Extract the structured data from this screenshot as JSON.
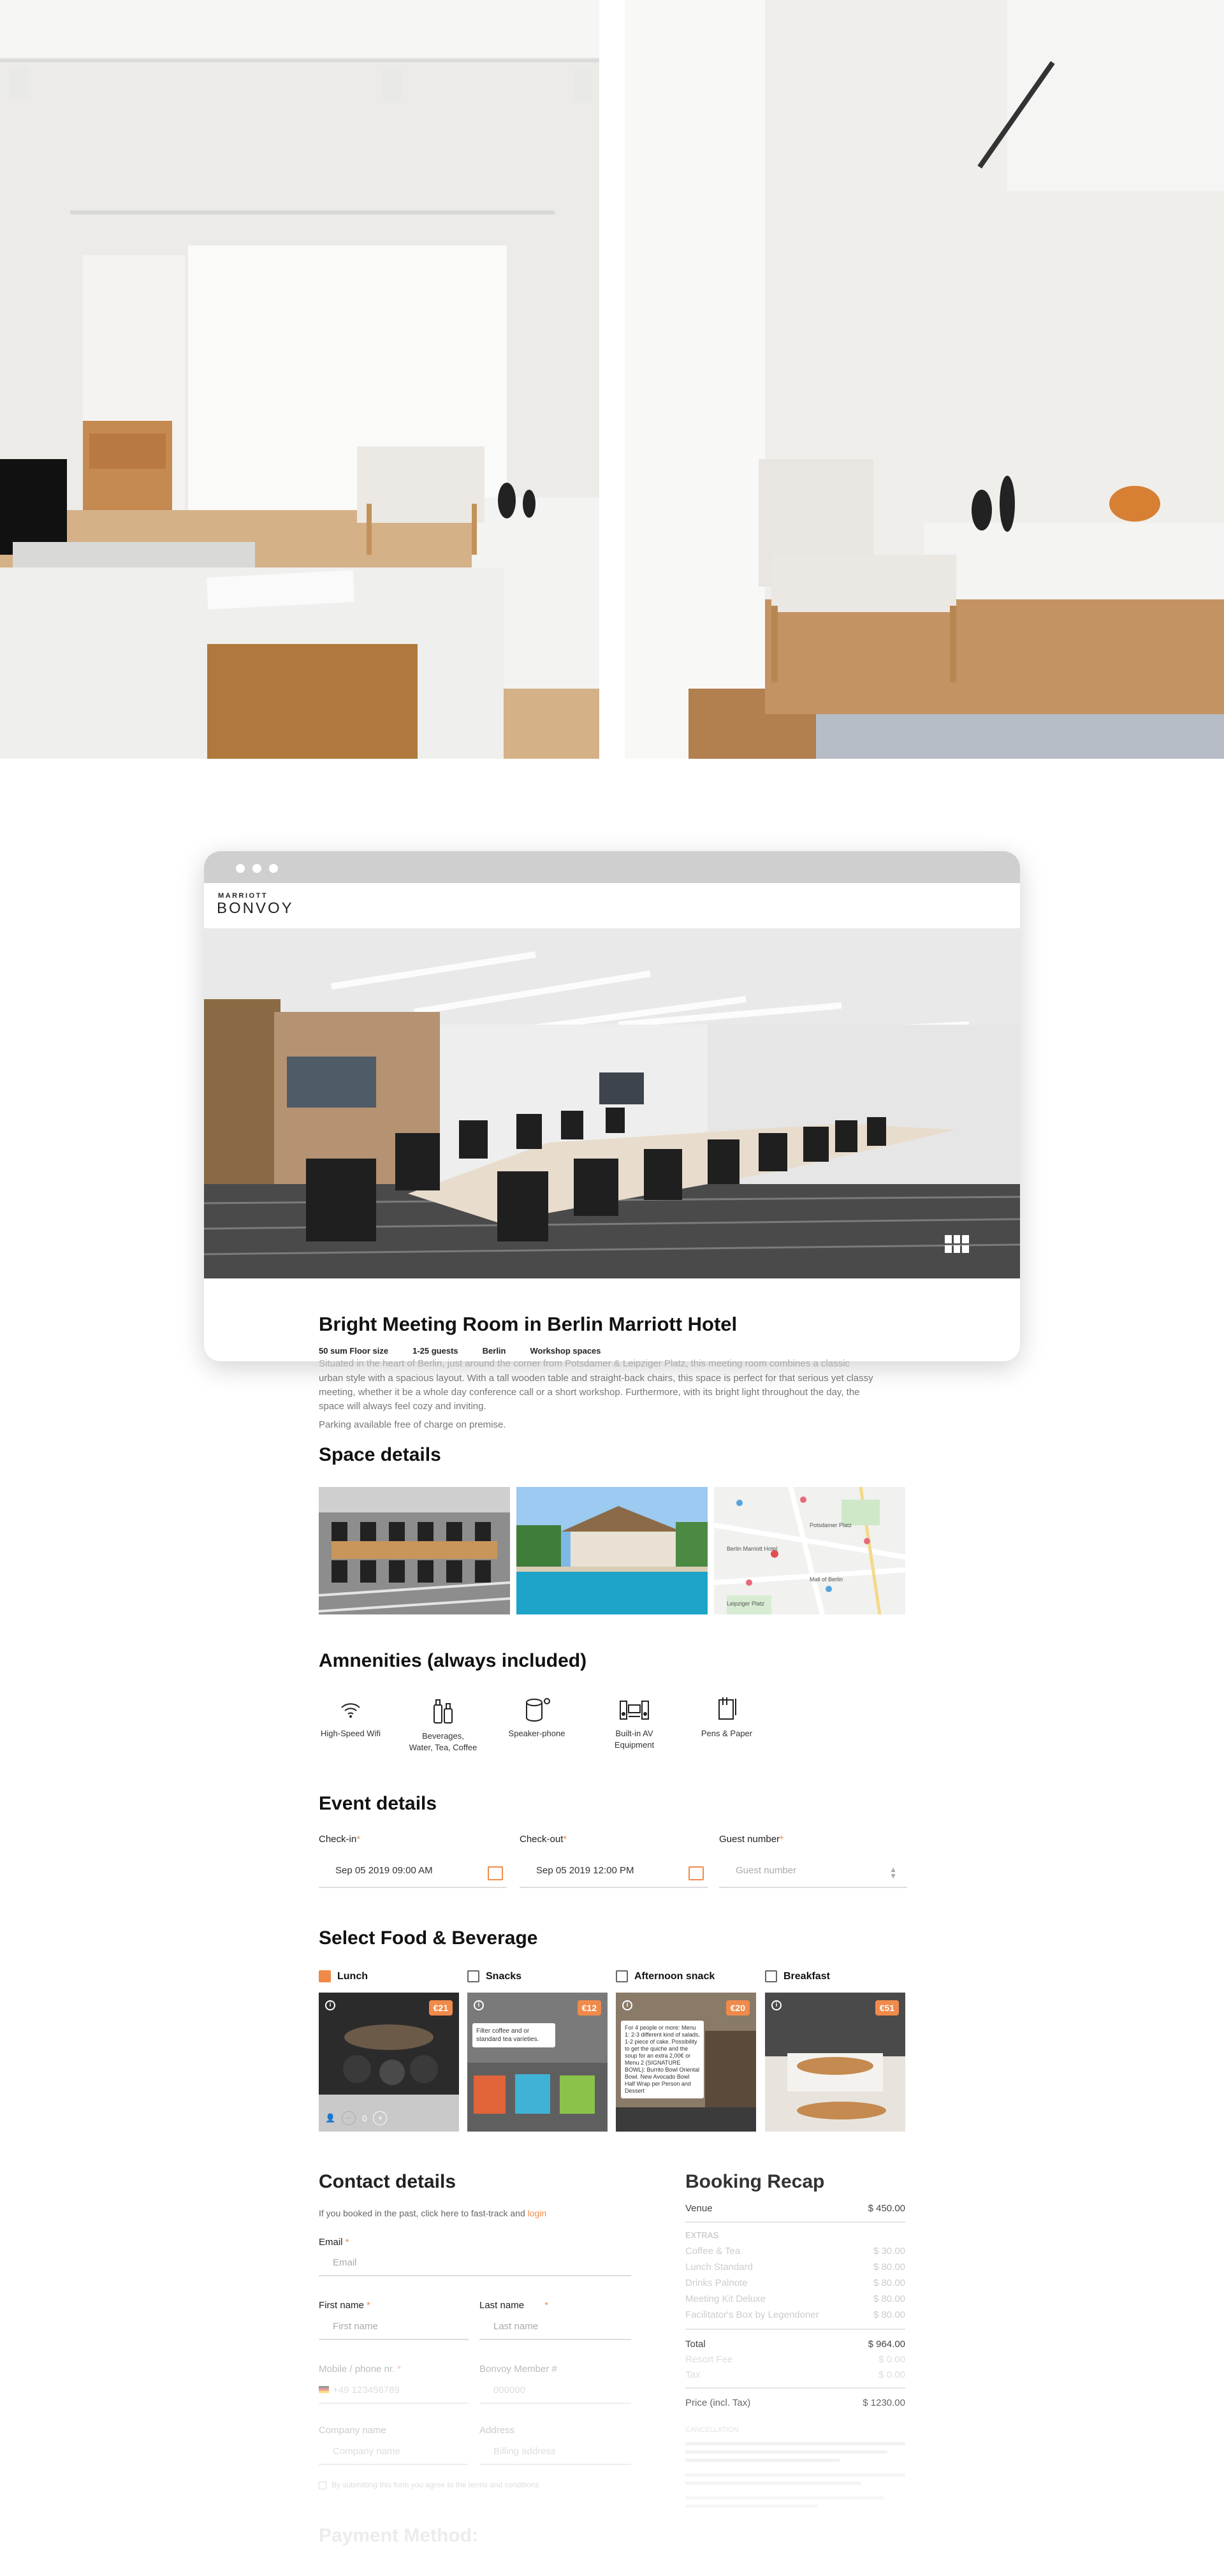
{
  "space": {
    "title": "Bright Meeting Room in Berlin Marriott Hotel",
    "tags": [
      "50 sum Floor size",
      "1-25 guests",
      "Berlin",
      "Workshop spaces"
    ],
    "desc_top": "Situated in the heart of Berlin, just around the corner from Potsdamer & Leipziger Platz, this meeting room combines a classic",
    "desc_lines": [
      "urban style with a spacious layout. With a tall wooden table and straight-back chairs, this space is perfect for that serious yet classy",
      "meeting, whether it be a whole day conference call or a short workshop. Furthermore, with its bright light throughout the day, the",
      "space will always feel cozy and inviting."
    ],
    "parking": "Parking available free of charge on premise."
  },
  "brand": {
    "line1": "MARRIOTT",
    "line2": "BONVOY"
  },
  "sections": {
    "space_details": "Space details",
    "amenities": "Amnenities (always included)",
    "event": "Event details",
    "food": "Select Food & Beverage",
    "contact": "Contact details",
    "recap": "Booking Recap",
    "payment": "Payment Method:"
  },
  "map_labels": [
    "Berlin Marriott Hotel",
    "Potsdamer Platz",
    "Mall of Berlin",
    "Leipziger Platz"
  ],
  "amenities": [
    {
      "icon": "wifi-icon",
      "label": "High-Speed Wifi"
    },
    {
      "icon": "beverages-icon",
      "label": "Beverages,",
      "label2": "Water, Tea, Coffee"
    },
    {
      "icon": "speakerphone-icon",
      "label": "Speaker-phone"
    },
    {
      "icon": "av-equipment-icon",
      "label": "Built-in AV Equipment"
    },
    {
      "icon": "pens-paper-icon",
      "label": "Pens & Paper"
    }
  ],
  "event": {
    "checkin_label": "Check-in",
    "checkin_value": "Sep 05 2019 09:00 AM",
    "checkout_label": "Check-out",
    "checkout_value": "Sep 05 2019 12:00 PM",
    "guests_label": "Guest number",
    "guests_placeholder": "Guest number",
    "required": "*"
  },
  "food": [
    {
      "label": "Lunch",
      "checked": true,
      "price": "€21",
      "qty": "0"
    },
    {
      "label": "Snacks",
      "checked": false,
      "price": "€12",
      "tip": "Filter coffee and or standard tea varieties."
    },
    {
      "label": "Afternoon snack",
      "checked": false,
      "price": "€20",
      "tip": "For 4 people or more: Menu 1: 2-3 different kind of salads, 1-2 piece of cake. Possibility to get the quiche and the soup for an extra 2,00€ or Menu 2 (SIGNATURE BOWL): Burrito Bowl Oriental Bowl. New Avocado Bowl Half Wrap per Person and Dessert"
    },
    {
      "label": "Breakfast",
      "checked": false,
      "price": "€51"
    }
  ],
  "contact": {
    "intro": "If you booked in the past, click here to fast-track and",
    "login": "login",
    "email_label": "Email",
    "email_ph": "Email",
    "first_label": "First name",
    "first_ph": "First name",
    "last_label": "Last name",
    "last_ph": "Last name",
    "mobile_label": "Mobile / phone nr.",
    "mobile_ph": "+49 123456789",
    "bonvoy_label": "Bonvoy Member #",
    "bonvoy_ph": "000000",
    "company_label": "Company name",
    "company_ph": "Company name",
    "address_label": "Address",
    "address_ph": "Billing address",
    "consent": "By submitting this form you agree to the terms and conditions"
  },
  "recap": {
    "venue_label": "Venue",
    "venue_value": "$ 450.00",
    "extras_label": "EXTRAS",
    "extras": [
      {
        "label": "Coffee & Tea",
        "value": "$ 30.00"
      },
      {
        "label": "Lunch Standard",
        "value": "$ 80.00"
      },
      {
        "label": "Drinks Palnote",
        "value": "$ 80.00"
      },
      {
        "label": "Meeting Kit Deluxe",
        "value": "$ 80.00"
      },
      {
        "label": "Facilitator's Box by Legendoner",
        "value": "$ 80.00"
      }
    ],
    "total_label": "Total",
    "total_value": "$ 964.00",
    "resort_label": "Resort Fee",
    "resort_value": "$ 0.00",
    "tax_label": "Tax",
    "tax_value": "$ 0.00",
    "price_label": "Price (incl. Tax)",
    "price_value": "$ 1230.00",
    "cancel_label": "CANCELLATION"
  },
  "colors": {
    "accent": "#f08a4b",
    "text": "#111111",
    "muted": "#777777"
  }
}
